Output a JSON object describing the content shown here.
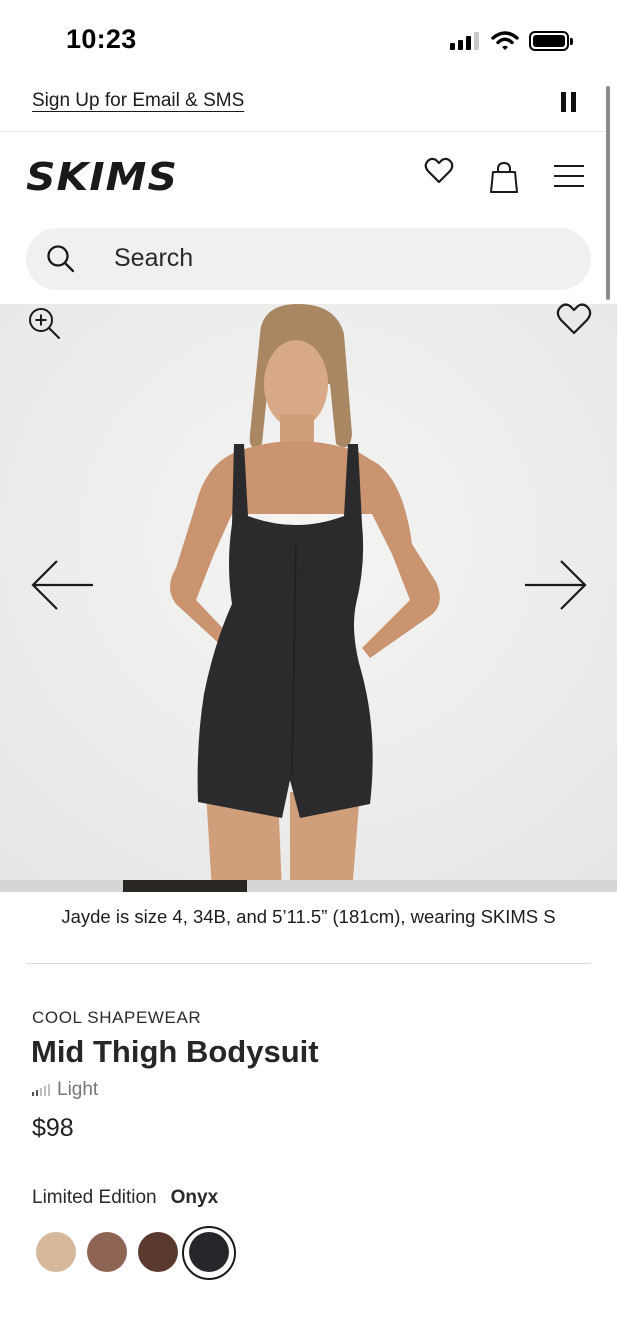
{
  "status_bar": {
    "time": "10:23"
  },
  "promo": {
    "link_text": "Sign Up for Email & SMS"
  },
  "header": {
    "brand": "SKIMS"
  },
  "search": {
    "placeholder": "Search"
  },
  "gallery": {
    "progress_current_fraction_start": 0.2,
    "progress_current_fraction_end": 0.4,
    "model_caption": "Jayde is size 4, 34B, and 5’11.5” (181cm), wearing SKIMS S"
  },
  "product": {
    "category": "COOL SHAPEWEAR",
    "title": "Mid Thigh Bodysuit",
    "compression": "Light",
    "compression_level_of_5": 2,
    "price": "$98"
  },
  "colors": {
    "label": "Limited Edition",
    "selected_name": "Onyx",
    "swatches": [
      {
        "name": "sand",
        "hex": "#d6b99b"
      },
      {
        "name": "cocoa",
        "hex": "#8e6455"
      },
      {
        "name": "espresso",
        "hex": "#5a3a2e"
      },
      {
        "name": "onyx",
        "hex": "#25272b",
        "selected": true
      }
    ]
  },
  "theme": {
    "accent": "#1a1a1a",
    "search_bg": "#f1f0ee",
    "image_bg": "#ededed"
  }
}
